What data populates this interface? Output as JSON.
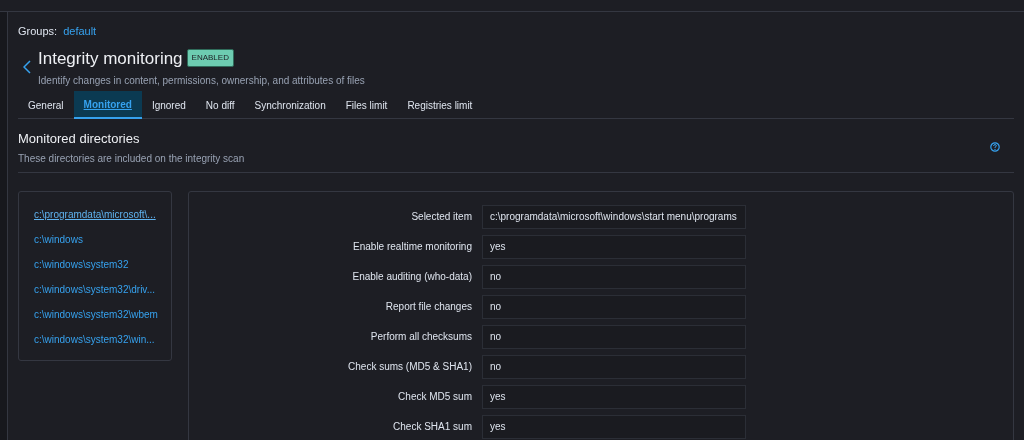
{
  "groups": {
    "label": "Groups:",
    "value": "default"
  },
  "header": {
    "title": "Integrity monitoring",
    "badge": "ENABLED",
    "subtitle": "Identify changes in content, permissions, ownership, and attributes of files"
  },
  "tabs": [
    {
      "label": "General",
      "selected": false
    },
    {
      "label": "Monitored",
      "selected": true
    },
    {
      "label": "Ignored",
      "selected": false
    },
    {
      "label": "No diff",
      "selected": false
    },
    {
      "label": "Synchronization",
      "selected": false
    },
    {
      "label": "Files limit",
      "selected": false
    },
    {
      "label": "Registries limit",
      "selected": false
    }
  ],
  "section": {
    "title": "Monitored directories",
    "subtitle": "These directories are included on the integrity scan"
  },
  "directories": [
    {
      "label": "c:\\programdata\\microsoft\\...",
      "selected": true
    },
    {
      "label": "c:\\windows",
      "selected": false
    },
    {
      "label": "c:\\windows\\system32",
      "selected": false
    },
    {
      "label": "c:\\windows\\system32\\driv...",
      "selected": false
    },
    {
      "label": "c:\\windows\\system32\\wbem",
      "selected": false
    },
    {
      "label": "c:\\windows\\system32\\win...",
      "selected": false
    }
  ],
  "details": [
    {
      "label": "Selected item",
      "value": "c:\\programdata\\microsoft\\windows\\start menu\\programs"
    },
    {
      "label": "Enable realtime monitoring",
      "value": "yes"
    },
    {
      "label": "Enable auditing (who-data)",
      "value": "no"
    },
    {
      "label": "Report file changes",
      "value": "no"
    },
    {
      "label": "Perform all checksums",
      "value": "no"
    },
    {
      "label": "Check sums (MD5 & SHA1)",
      "value": "no"
    },
    {
      "label": "Check MD5 sum",
      "value": "yes"
    },
    {
      "label": "Check SHA1 sum",
      "value": "yes"
    }
  ]
}
